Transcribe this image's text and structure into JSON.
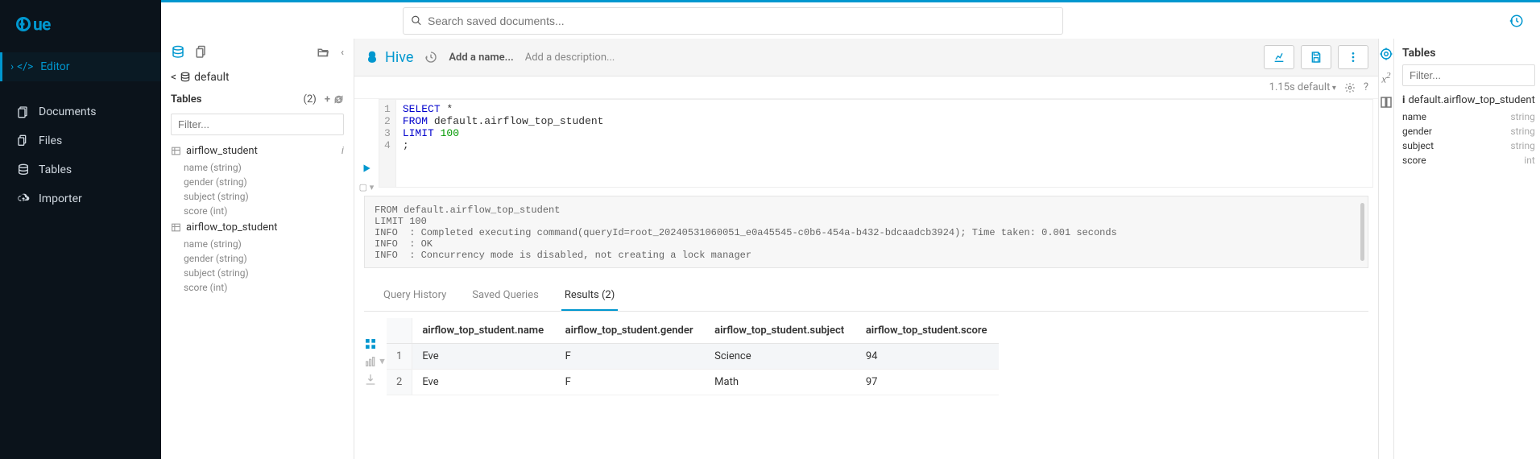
{
  "nav": {
    "editor": "Editor",
    "documents": "Documents",
    "files": "Files",
    "tables": "Tables",
    "importer": "Importer"
  },
  "search": {
    "placeholder": "Search saved documents..."
  },
  "assist": {
    "breadcrumb": "default",
    "tables_label": "Tables",
    "count": "(2)",
    "filter_placeholder": "Filter...",
    "tables": [
      {
        "name": "airflow_student",
        "columns": [
          "name (string)",
          "gender (string)",
          "subject (string)",
          "score (int)"
        ]
      },
      {
        "name": "airflow_top_student",
        "columns": [
          "name (string)",
          "gender (string)",
          "subject (string)",
          "score (int)"
        ]
      }
    ]
  },
  "editor": {
    "engine": "Hive",
    "add_name": "Add a name...",
    "add_desc": "Add a description...",
    "timing": "1.15s default",
    "code": {
      "l1_kw": "SELECT",
      "l1_rest": " *",
      "l2_kw": "FROM",
      "l2_rest": " default.airflow_top_student",
      "l3_kw": "LIMIT",
      "l3_num": " 100",
      "l4": ";"
    },
    "log": "FROM default.airflow_top_student\nLIMIT 100\nINFO  : Completed executing command(queryId=root_20240531060051_e0a45545-c0b6-454a-b432-bdcaadcb3924); Time taken: 0.001 seconds\nINFO  : OK\nINFO  : Concurrency mode is disabled, not creating a lock manager"
  },
  "tabs": {
    "history": "Query History",
    "saved": "Saved Queries",
    "results": "Results (2)"
  },
  "results": {
    "headers": [
      "",
      "airflow_top_student.name",
      "airflow_top_student.gender",
      "airflow_top_student.subject",
      "airflow_top_student.score"
    ],
    "rows": [
      [
        "1",
        "Eve",
        "F",
        "Science",
        "94"
      ],
      [
        "2",
        "Eve",
        "F",
        "Math",
        "97"
      ]
    ]
  },
  "right": {
    "title": "Tables",
    "filter_placeholder": "Filter...",
    "table": "default.airflow_top_student",
    "cols": [
      {
        "name": "name",
        "type": "string"
      },
      {
        "name": "gender",
        "type": "string"
      },
      {
        "name": "subject",
        "type": "string"
      },
      {
        "name": "score",
        "type": "int"
      }
    ]
  }
}
